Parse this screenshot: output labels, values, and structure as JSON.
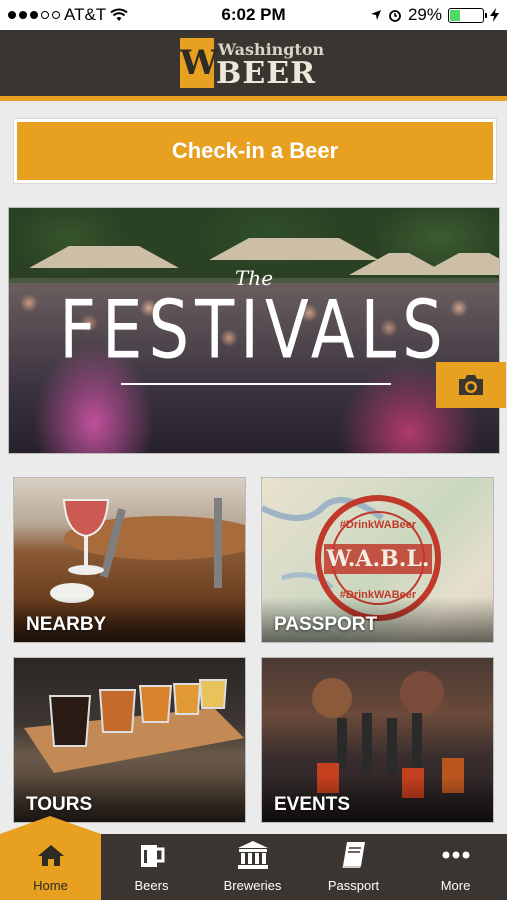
{
  "status": {
    "carrier": "AT&T",
    "time": "6:02 PM",
    "battery": "29%"
  },
  "header": {
    "logo_top": "Washington",
    "logo_bottom": "BEER",
    "logo_letter": "W"
  },
  "checkin": {
    "label": "Check-in a Beer"
  },
  "hero": {
    "the": "The",
    "title": "FESTIVALS"
  },
  "tiles": [
    {
      "label": "NEARBY"
    },
    {
      "label": "PASSPORT",
      "stamp_top": "#DrinkWABeer",
      "stamp_main": "W.A.B.L.",
      "stamp_bottom": "#DrinkWABeer"
    },
    {
      "label": "TOURS"
    },
    {
      "label": "EVENTS"
    }
  ],
  "tabs": [
    {
      "label": "Home",
      "icon": "home-icon"
    },
    {
      "label": "Beers",
      "icon": "beer-mug-icon"
    },
    {
      "label": "Breweries",
      "icon": "building-icon"
    },
    {
      "label": "Passport",
      "icon": "book-icon"
    },
    {
      "label": "More",
      "icon": "more-dots-icon"
    }
  ],
  "colors": {
    "accent": "#e8a020",
    "header_bg": "#3a3530",
    "page_bg": "#ebebeb"
  }
}
